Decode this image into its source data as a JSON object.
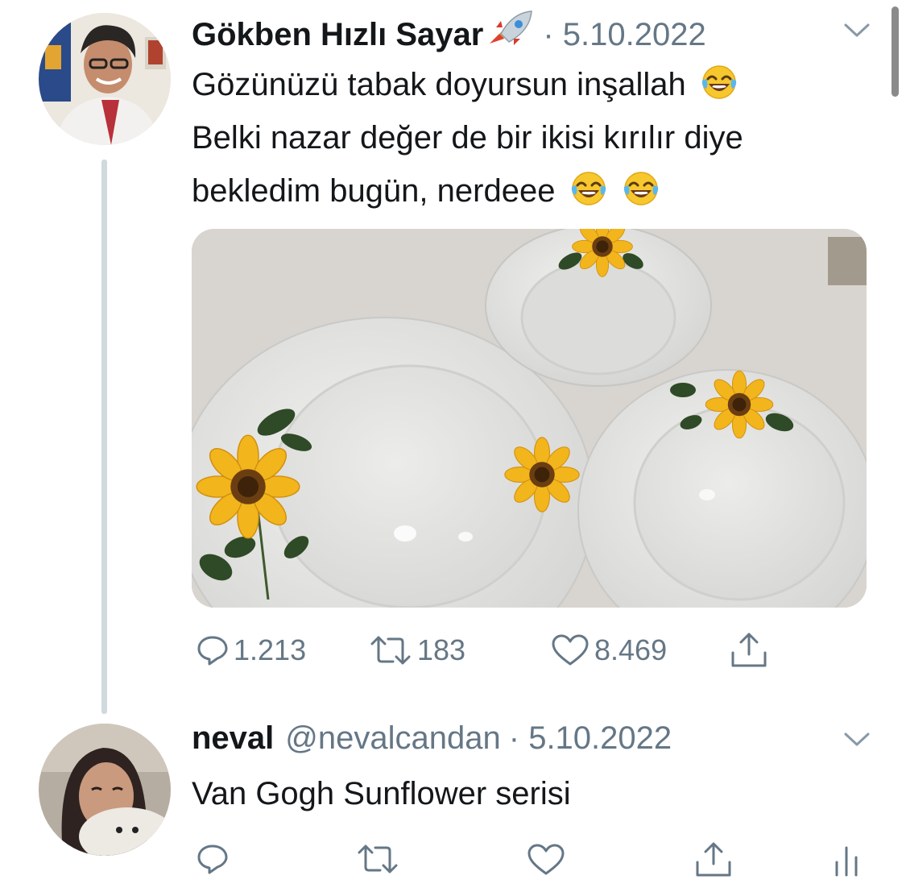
{
  "tweet": {
    "author_name": "Gökben Hızlı Sayar",
    "author_emoji": "rocket-emoji",
    "date": "· 5.10.2022",
    "text_lines": [
      "Gözünüzü tabak doyursun inşallah",
      "Belki nazar değer de bir ikisi kırılır diye",
      "bekledim bugün, nerdeee"
    ],
    "line_emoji": "face-with-tears-of-joy-emoji",
    "media_alt": "sunflower-pattern-plates-photo",
    "replies": "1.213",
    "retweets": "183",
    "likes": "8.469"
  },
  "reply": {
    "author_name": "neval",
    "handle": "@nevalcandan",
    "date": "· 5.10.2022",
    "text": "Van Gogh Sunflower serisi"
  },
  "colors": {
    "text": "#14171a",
    "secondary": "#657786",
    "thread_line": "#cfd9de"
  }
}
